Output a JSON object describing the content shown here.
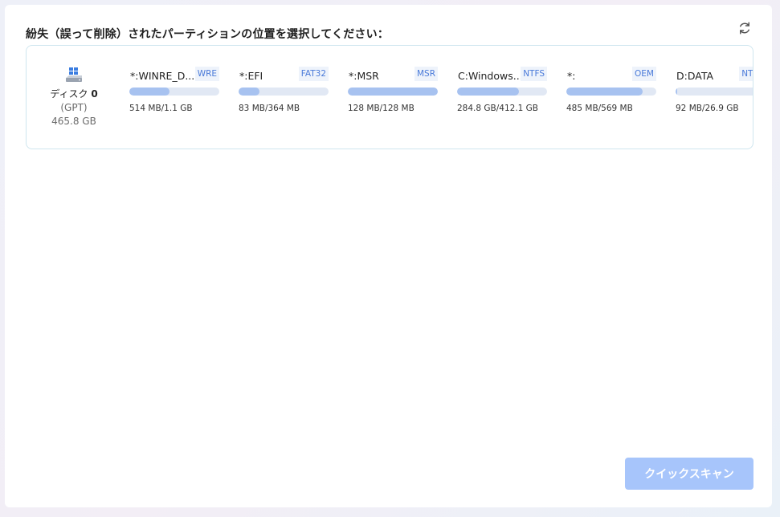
{
  "header": {
    "title": "紛失（誤って削除）されたパーティションの位置を選択してください：",
    "refresh_icon": "refresh-icon"
  },
  "disk": {
    "icon": "windows-disk-icon",
    "name_prefix": "ディスク",
    "number": "0",
    "type": "(GPT)",
    "size": "465.8 GB",
    "partitions": [
      {
        "name": "*:WINRE_D...",
        "fs": "WRE",
        "usage": "514 MB/1.1 GB",
        "fill": 0.45
      },
      {
        "name": "*:EFI",
        "fs": "FAT32",
        "usage": "83 MB/364 MB",
        "fill": 0.23
      },
      {
        "name": "*:MSR",
        "fs": "MSR",
        "usage": "128 MB/128 MB",
        "fill": 1.0
      },
      {
        "name": "C:Windows...",
        "fs": "NTFS",
        "usage": "284.8 GB/412.1 GB",
        "fill": 0.69
      },
      {
        "name": "*:",
        "fs": "OEM",
        "usage": "485 MB/569 MB",
        "fill": 0.85
      },
      {
        "name": "D:DATA",
        "fs": "NTFS",
        "usage": "92 MB/26.9 GB",
        "fill": 0.02
      }
    ]
  },
  "actions": {
    "quick_scan_label": "クイックスキャン"
  },
  "colors": {
    "bar_fill": "#a7c2f0",
    "bar_track": "#e1e8f4",
    "fs_badge_text": "#4a7ad9",
    "button": "#a7c5fb",
    "card_border": "#cfe6ef"
  }
}
